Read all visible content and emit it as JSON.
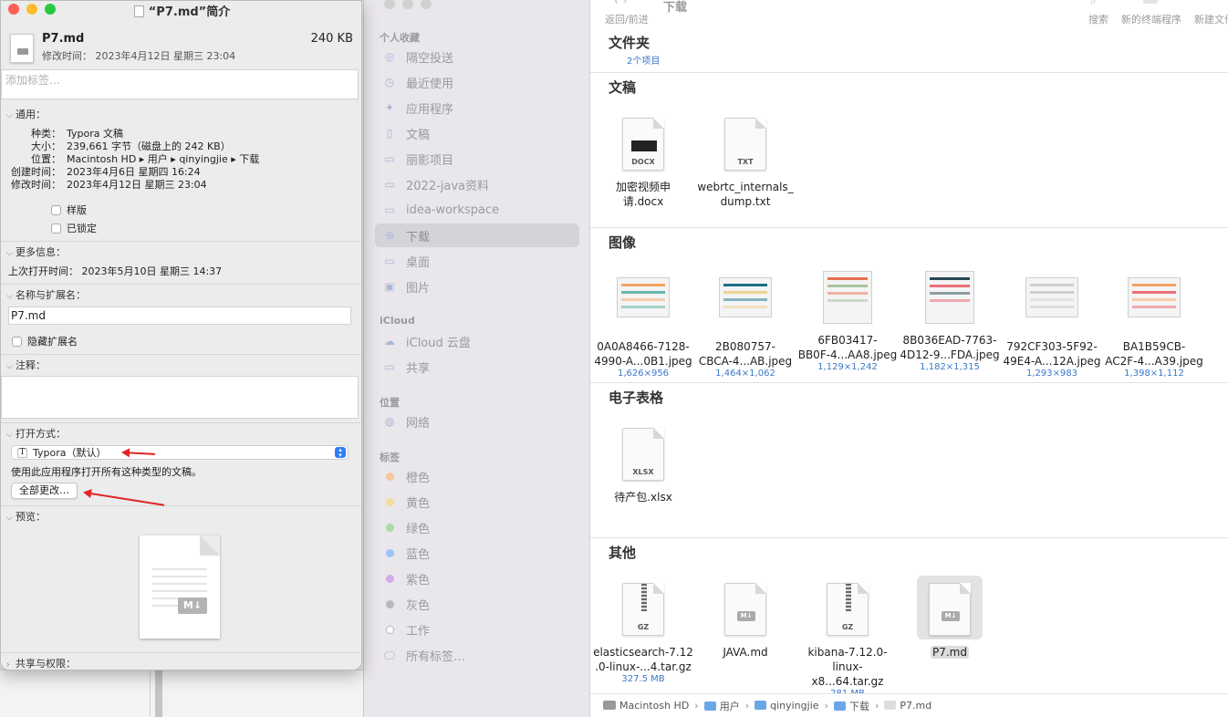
{
  "info": {
    "title": "“P7.md”简介",
    "file_name": "P7.md",
    "file_size": "240 KB",
    "modified_line": "修改时间： 2023年4月12日 星期三 23:04",
    "tag_placeholder": "添加标签…",
    "general": {
      "header": "通用：",
      "kind_k": "种类：",
      "kind_v": "Typora 文稿",
      "size_k": "大小：",
      "size_v": "239,661 字节（磁盘上的 242 KB）",
      "where_k": "位置：",
      "where_v": "Macintosh HD ▸ 用户 ▸ qinyingjie ▸ 下载",
      "created_k": "创建时间：",
      "created_v": "2023年4月6日 星期四 16:24",
      "modified_k": "修改时间：",
      "modified_v": "2023年4月12日 星期三 23:04",
      "stationery": "样版",
      "locked": "已锁定"
    },
    "more": {
      "header": "更多信息：",
      "last_opened": "上次打开时间： 2023年5月10日 星期三 14:37"
    },
    "name_ext": {
      "header": "名称与扩展名：",
      "value": "P7.md",
      "hide_ext": "隐藏扩展名"
    },
    "comments": {
      "header": "注释："
    },
    "open_with": {
      "header": "打开方式：",
      "app_icon": "T",
      "app": "Typora（默认）",
      "desc": "使用此应用程序打开所有这种类型的文稿。",
      "change_all": "全部更改…"
    },
    "preview": {
      "header": "预览："
    },
    "sharing": {
      "header": "共享与权限："
    }
  },
  "finder": {
    "toolbar": {
      "nav": "返回/前进",
      "title": "下载",
      "search": "搜索",
      "terminal": "新的终端程序",
      "newfile": "新建文件"
    },
    "sidebar": {
      "favorites_title": "个人收藏",
      "favorites": [
        {
          "label": "隔空投送",
          "icon": "airdrop-icon",
          "glyph": "◎"
        },
        {
          "label": "最近使用",
          "icon": "clock-icon",
          "glyph": "◷"
        },
        {
          "label": "应用程序",
          "icon": "apps-icon",
          "glyph": "✦"
        },
        {
          "label": "文稿",
          "icon": "document-icon",
          "glyph": "▯"
        },
        {
          "label": "丽影项目",
          "icon": "folder-icon",
          "glyph": "▭"
        },
        {
          "label": "2022-java资料",
          "icon": "folder-icon",
          "glyph": "▭"
        },
        {
          "label": "idea-workspace",
          "icon": "folder-icon",
          "glyph": "▭"
        },
        {
          "label": "下载",
          "icon": "download-icon",
          "glyph": "⊕"
        },
        {
          "label": "桌面",
          "icon": "desktop-icon",
          "glyph": "▭"
        },
        {
          "label": "图片",
          "icon": "pictures-icon",
          "glyph": "▣"
        }
      ],
      "icloud_title": "iCloud",
      "icloud": [
        {
          "label": "iCloud 云盘",
          "icon": "cloud-icon",
          "glyph": "☁"
        },
        {
          "label": "共享",
          "icon": "shared-folder-icon",
          "glyph": "▭"
        }
      ],
      "locations_title": "位置",
      "locations": [
        {
          "label": "网络",
          "icon": "globe-icon",
          "glyph": "◍"
        }
      ],
      "tags_title": "标签",
      "tags": [
        {
          "label": "橙色",
          "color": "#f5c99a"
        },
        {
          "label": "黄色",
          "color": "#f3dd96"
        },
        {
          "label": "绿色",
          "color": "#a8dca0"
        },
        {
          "label": "蓝色",
          "color": "#9fc2f4"
        },
        {
          "label": "紫色",
          "color": "#d3a9e6"
        },
        {
          "label": "灰色",
          "color": "#b9b9b9"
        },
        {
          "label": "工作",
          "color": "#ffffff"
        },
        {
          "label": "所有标签…",
          "color": "none"
        }
      ]
    },
    "groups": {
      "folders": {
        "title": "文件夹",
        "count": "2个项目"
      },
      "documents": {
        "title": "文稿",
        "files": [
          {
            "name1": "加密视频申",
            "name2": "请.docx",
            "ext": "DOCX"
          },
          {
            "name1": "webrtc_internals_",
            "name2": "dump.txt",
            "ext": "TXT"
          }
        ]
      },
      "images": {
        "title": "图像",
        "files": [
          {
            "name1": "0A0A8466-7128-",
            "name2": "4990-A...0B1.jpeg",
            "dims": "1,626×956"
          },
          {
            "name1": "2B080757-",
            "name2": "CBCA-4...AB.jpeg",
            "dims": "1,464×1,062"
          },
          {
            "name1": "6FB03417-",
            "name2": "BB0F-4...AA8.jpeg",
            "dims": "1,129×1,242"
          },
          {
            "name1": "8B036EAD-7763-",
            "name2": "4D12-9...FDA.jpeg",
            "dims": "1,182×1,315"
          },
          {
            "name1": "792CF303-5F92-",
            "name2": "49E4-A...12A.jpeg",
            "dims": "1,293×983"
          },
          {
            "name1": "BA1B59CB-",
            "name2": "AC2F-4...A39.jpeg",
            "dims": "1,398×1,112"
          }
        ]
      },
      "spreadsheets": {
        "title": "电子表格",
        "files": [
          {
            "name1": "待产包.xlsx",
            "ext": "XLSX"
          }
        ]
      },
      "other": {
        "title": "其他",
        "files": [
          {
            "name1": "elasticsearch-7.12",
            "name2": ".0-linux-...4.tar.gz",
            "sub": "327.5 MB",
            "ext": "GZ"
          },
          {
            "name1": "JAVA.md",
            "name2": "",
            "sub": "",
            "ext": "M↓"
          },
          {
            "name1": "kibana-7.12.0-",
            "name2": "linux-x8...64.tar.gz",
            "sub": "281 MB",
            "ext": "GZ"
          },
          {
            "name1": "P7.md",
            "name2": "",
            "sub": "",
            "ext": "M↓"
          }
        ]
      }
    },
    "path": [
      "Macintosh HD",
      "用户",
      "qinyingjie",
      "下载",
      "P7.md"
    ]
  },
  "colors": {
    "close": "#fe5f57",
    "minimize": "#febc2e",
    "zoom": "#28c840",
    "annotation_arrow": "#e02424"
  }
}
